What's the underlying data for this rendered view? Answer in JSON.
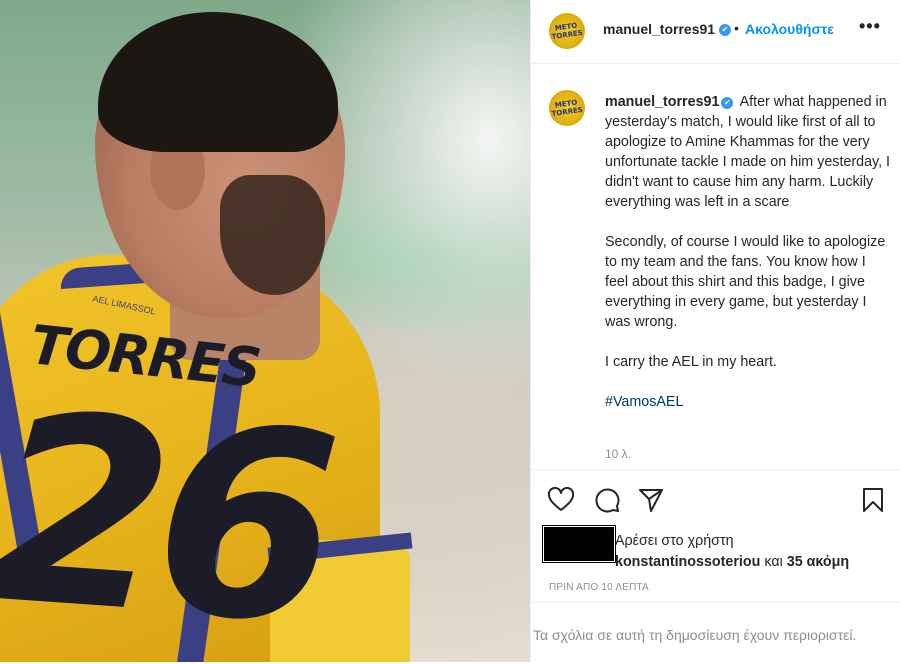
{
  "photo": {
    "jersey_name": "TORRES",
    "jersey_number": "26",
    "collar_text": "AEL LIMASSOL"
  },
  "header": {
    "username": "manuel_torres91",
    "verified_glyph": "✔",
    "separator": "•",
    "follow_label": "Ακολουθήστε",
    "more_glyph": "•••"
  },
  "avatar": {
    "badge_line1": "ΜΕΤΟ",
    "badge_line2": "TORRES"
  },
  "caption": {
    "username": "manuel_torres91",
    "paragraph1": "After what happened in yesterday's match, I would like first of all to apologize to Amine Khammas for the very unfortunate tackle I made on him yesterday, I didn't want to cause him any harm. Luckily everything was left in a scare",
    "paragraph2": "Secondly, of course I would like to apologize to my team and the fans. You know how I feel about this shirt and this badge, I give everything in every game, but yesterday I was wrong.",
    "paragraph3": "I carry the AEL in my heart.",
    "hashtag": "#VamosAEL",
    "time_ago": "10 λ."
  },
  "icons": {
    "like": "heart-icon",
    "comment": "comment-icon",
    "share": "paper-plane-icon",
    "save": "bookmark-icon"
  },
  "likes": {
    "line1": "Αρέσει στο χρήστη",
    "liker": "konstantinossoteriou",
    "conjunction": " και ",
    "others": "35 ακόμη"
  },
  "post_date": "ΠΡΙΝ ΑΠΟ 10 ΛΕΠΤΑ",
  "comments_disabled_text": "Τα σχόλια σε αυτή τη δημοσίευση έχουν περιοριστεί.",
  "colors": {
    "link_blue": "#0095f6",
    "verified_blue": "#3897f0",
    "hashtag": "#00376b",
    "muted": "#8e8e8e"
  }
}
